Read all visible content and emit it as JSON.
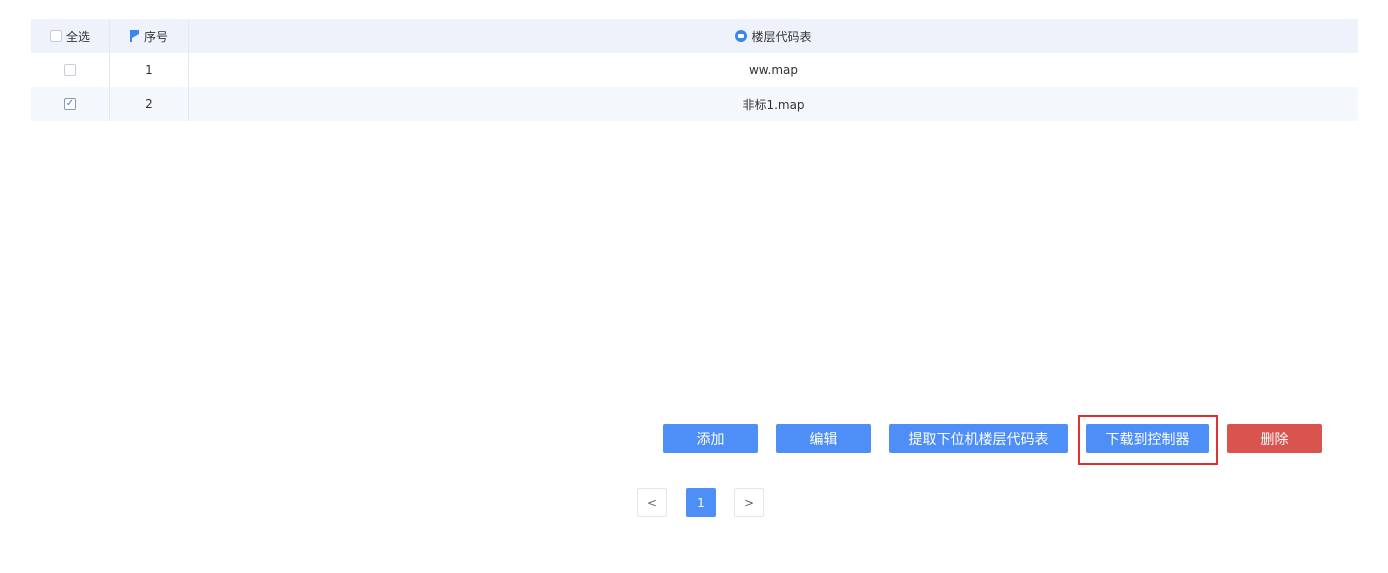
{
  "table": {
    "headers": {
      "select_all": "全选",
      "index": "序号",
      "name": "楼层代码表"
    },
    "rows": [
      {
        "index": "1",
        "name": "ww.map",
        "checked": false
      },
      {
        "index": "2",
        "name": "非标1.map",
        "checked": true
      }
    ]
  },
  "actions": {
    "add": "添加",
    "edit": "编辑",
    "fetch": "提取下位机楼层代码表",
    "download": "下载到控制器",
    "delete": "删除"
  },
  "pager": {
    "prev": "<",
    "current": "1",
    "next": ">"
  },
  "colors": {
    "primary": "#4e8ef7",
    "danger": "#d9534f",
    "highlight": "#e03131",
    "header_bg": "#eef3fb"
  },
  "icons": {
    "index_header": "flag-icon",
    "name_header": "circle-icon"
  }
}
